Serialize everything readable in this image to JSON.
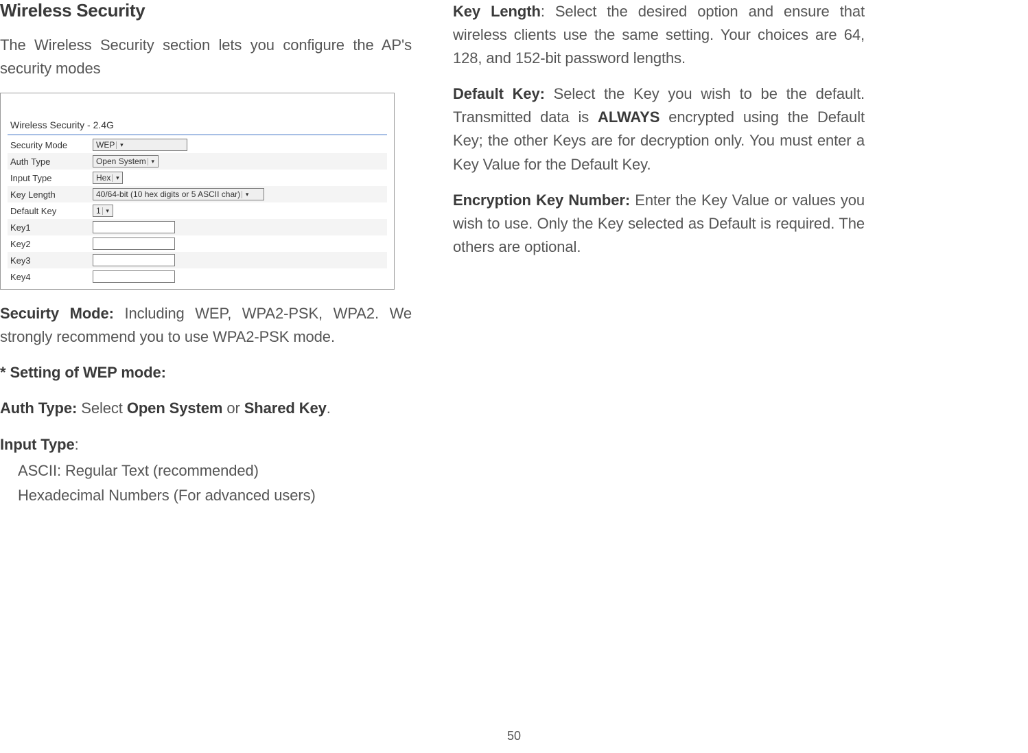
{
  "page_number": "50",
  "left": {
    "title": "Wireless Security",
    "intro": "The Wireless Security section lets you configure the AP's security modes",
    "panel": {
      "title": "Wireless Security - 2.4G",
      "rows": {
        "security_mode_label": "Security Mode",
        "security_mode_value": "WEP",
        "auth_type_label": "Auth Type",
        "auth_type_value": "Open System",
        "input_type_label": "Input Type",
        "input_type_value": "Hex",
        "key_length_label": "Key Length",
        "key_length_value": "40/64-bit (10 hex digits or 5 ASCII char)",
        "default_key_label": "Default Key",
        "default_key_value": "1",
        "key1": "Key1",
        "key2": "Key2",
        "key3": "Key3",
        "key4": "Key4"
      }
    },
    "security_mode_label": "Secuirty Mode:",
    "security_mode_text": " Including WEP, WPA2-PSK, WPA2. We strongly recommend you to use WPA2-PSK mode.",
    "wep_heading": "* Setting of WEP mode:",
    "auth_type_label": "Auth Type: ",
    "auth_type_text1": "Select ",
    "auth_type_text_open": "Open System",
    "auth_type_text_or": " or ",
    "auth_type_text_shared": "Shared Key",
    "auth_type_text_end": ".",
    "input_type_label": "Input Type",
    "input_type_colon": ":",
    "input_type_ascii": "ASCII: Regular Text (recommended)",
    "input_type_hex": "Hexadecimal Numbers (For advanced users)"
  },
  "right": {
    "key_length_label": "Key Length",
    "key_length_text": ": Select the desired option and ensure that wireless clients use the same setting. Your choices are 64, 128, and 152-bit password lengths.",
    "default_key_label": "Default Key:",
    "default_key_text1": " Select the Key you wish to be the default. Transmitted data is ",
    "default_key_always": "ALWAYS",
    "default_key_text2": " encrypted using the Default Key; the other Keys are for decryption only. You must enter a Key Value for the Default Key.",
    "enc_key_label": "Encryption Key Number:",
    "enc_key_text": " Enter the Key Value or values you wish to use. Only the Key selected as Default is required. The others are optional."
  }
}
